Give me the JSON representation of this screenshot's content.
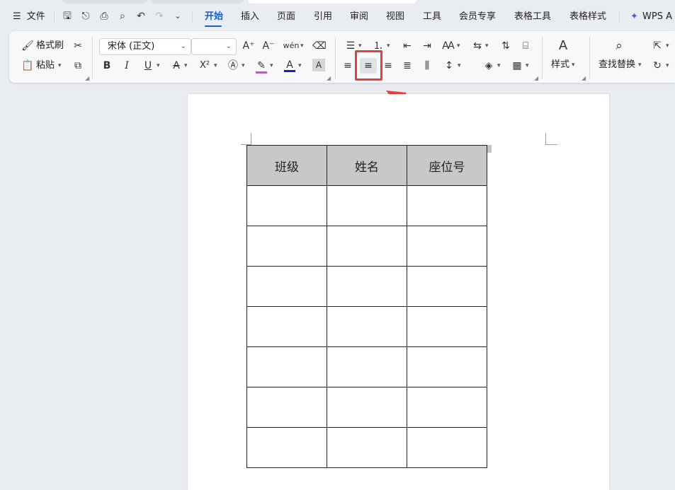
{
  "menu": {
    "file_label": "文件",
    "tabs": [
      "开始",
      "插入",
      "页面",
      "引用",
      "审阅",
      "视图",
      "工具",
      "会员专享",
      "表格工具",
      "表格样式"
    ],
    "active_tab": "开始",
    "wps_ai": "WPS A"
  },
  "ribbon": {
    "format_painter": "格式刷",
    "paste": "粘贴",
    "font_name": "宋体 (正文)",
    "font_size": "",
    "bold": "B",
    "italic": "I",
    "underline": "U",
    "superscript": "X²",
    "styles": "样式",
    "find_replace": "查找替换",
    "grow_font": "A⁺",
    "shrink_font": "A⁻",
    "phonetic": "wén",
    "font_color_accent": "#1a1acc",
    "highlight_accent": "#e83fd0"
  },
  "table": {
    "headers": [
      "班级",
      "姓名",
      "座位号"
    ],
    "rows": [
      [
        "",
        "",
        ""
      ],
      [
        "",
        "",
        ""
      ],
      [
        "",
        "",
        ""
      ],
      [
        "",
        "",
        ""
      ],
      [
        "",
        "",
        ""
      ],
      [
        "",
        "",
        ""
      ],
      [
        "",
        "",
        ""
      ]
    ]
  },
  "accent": {
    "highlight_box": "#ef3b3b",
    "active_tab": "#1a5fd0"
  }
}
